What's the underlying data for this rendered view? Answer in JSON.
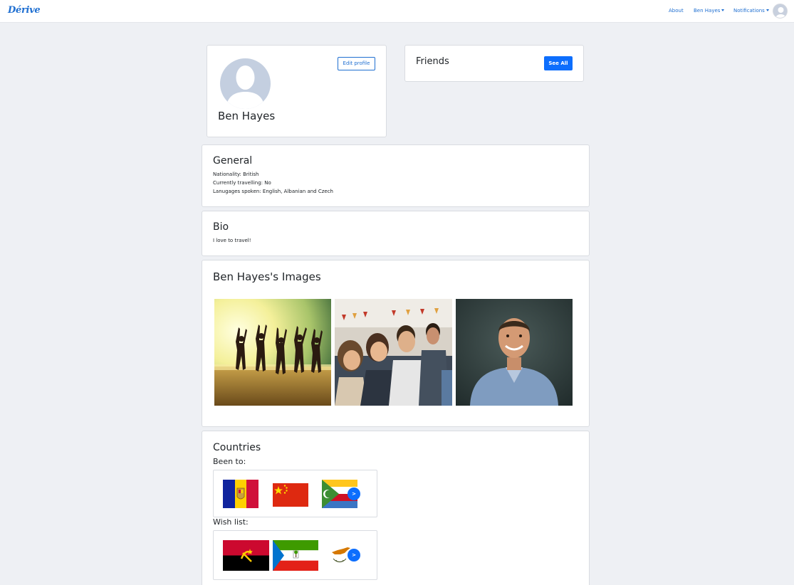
{
  "navbar": {
    "brand": "Dérive",
    "about": "About",
    "user_menu": "Ben Hayes",
    "notifications": "Notifications"
  },
  "profile": {
    "name": "Ben Hayes",
    "edit_button": "Edit profile"
  },
  "friends": {
    "title": "Friends",
    "see_all_button": "See All"
  },
  "general": {
    "title": "General",
    "nationality": "Nationality: British",
    "travelling": "Currently travelling: No",
    "languages": "Lanugages spoken: English, Albanian and Czech"
  },
  "bio": {
    "title": "Bio",
    "text": "I love to travel!"
  },
  "images": {
    "title": "Ben Hayes's Images",
    "items": [
      "beach-jump-photo",
      "friends-party-photo",
      "smiling-man-photo"
    ]
  },
  "countries": {
    "title": "Countries",
    "been_to_label": "Been to:",
    "wish_list_label": "Wish list:",
    "been_to": [
      "Andorra",
      "China",
      "Comoros"
    ],
    "wish_list": [
      "Angola",
      "Equatorial Guinea",
      "Cyprus"
    ],
    "next_label": ">"
  },
  "colors": {
    "accent": "#0d6efd",
    "link": "#1f6fd1",
    "background": "#eef0f4"
  }
}
